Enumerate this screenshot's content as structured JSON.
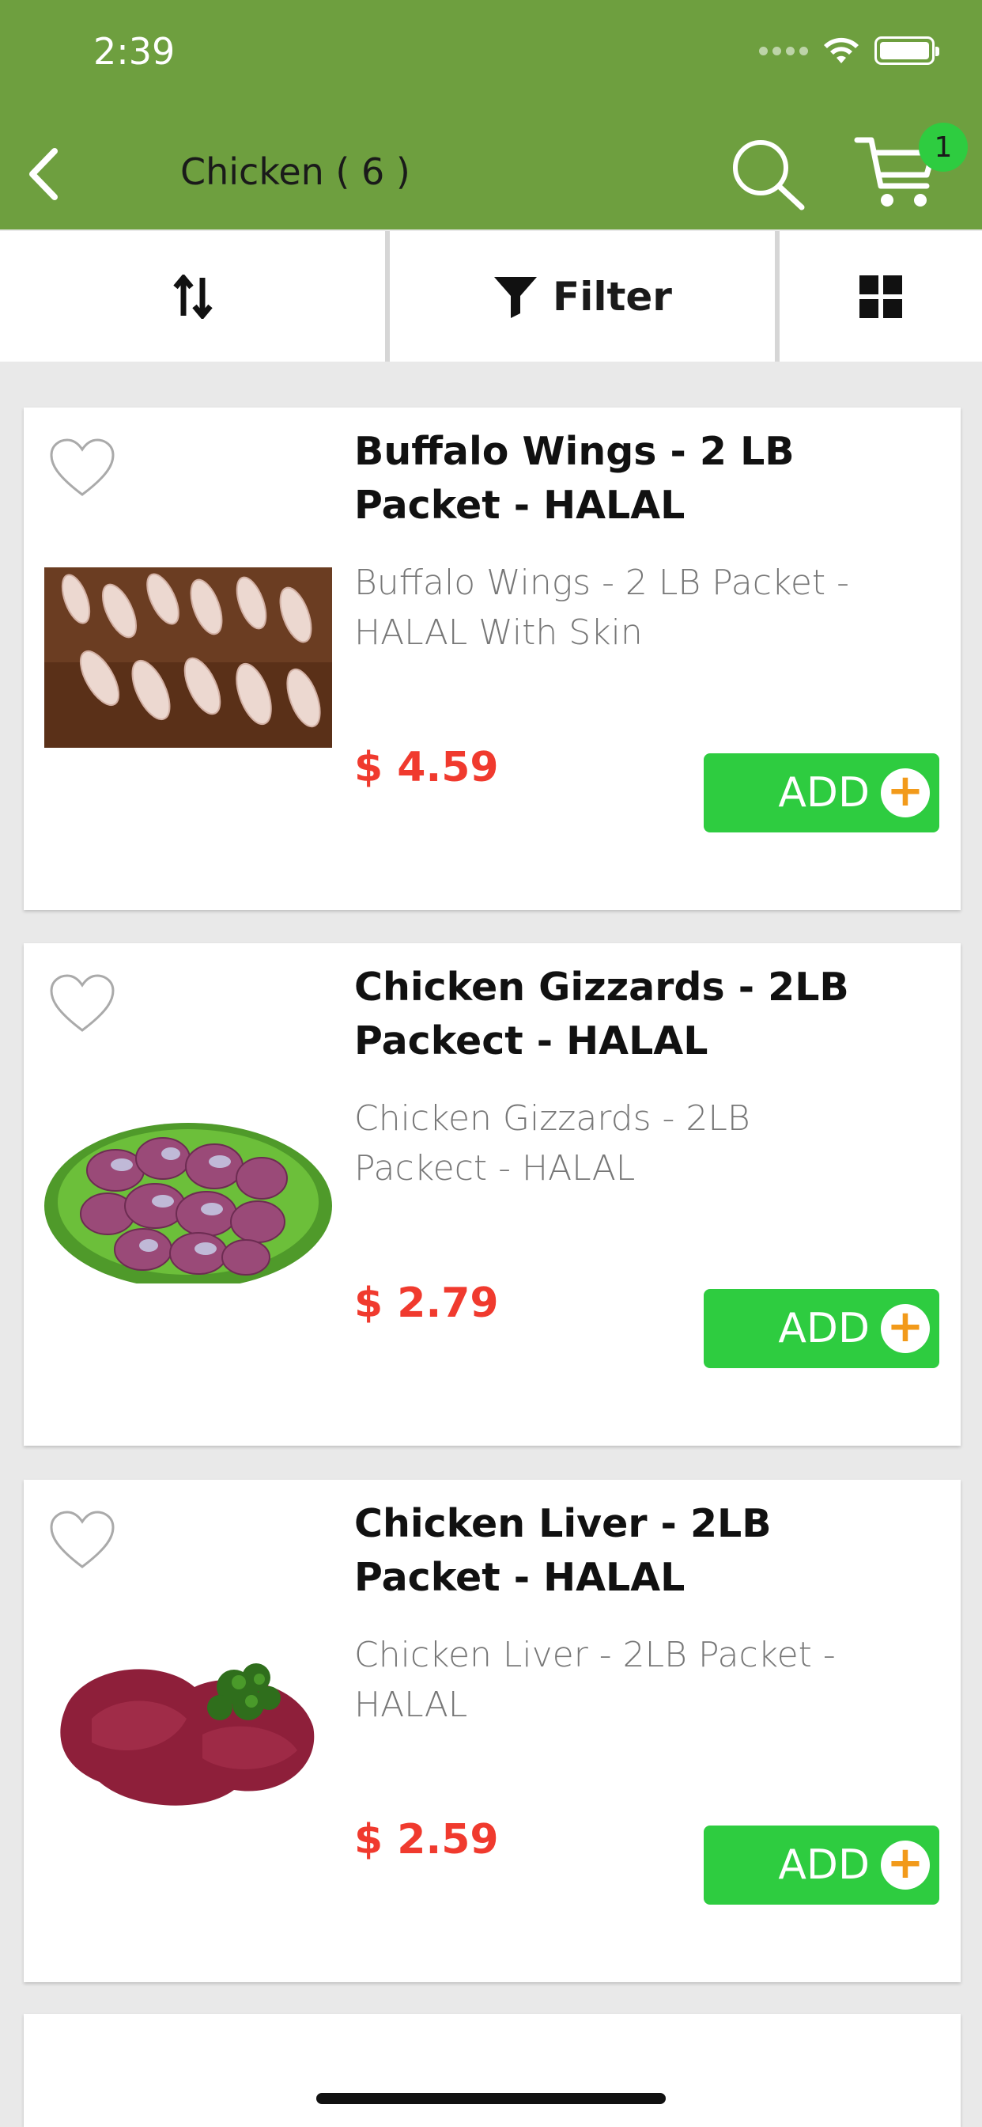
{
  "status_bar": {
    "time": "2:39"
  },
  "header": {
    "title": "Chicken ( 6 )",
    "cart_count": "1",
    "icons": {
      "back": "chevron-left-icon",
      "search": "search-icon",
      "cart": "cart-icon"
    }
  },
  "toolbar": {
    "filter_label": "Filter",
    "icons": {
      "sort": "sort-arrows-icon",
      "filter": "funnel-icon",
      "grid": "grid-view-icon"
    }
  },
  "products": [
    {
      "title": "Buffalo Wings - 2 LB Packet - HALAL",
      "description": "Buffalo Wings - 2 LB Packet - HALAL With Skin",
      "price": "$ 4.59",
      "add_label": "ADD",
      "image": "chicken-wings-image"
    },
    {
      "title": "Chicken Gizzards - 2LB Packect - HALAL",
      "description": "Chicken Gizzards - 2LB Packect - HALAL",
      "price": "$ 2.79",
      "add_label": "ADD",
      "image": "chicken-gizzards-image"
    },
    {
      "title": "Chicken Liver - 2LB Packet - HALAL",
      "description": "Chicken Liver - 2LB Packet - HALAL",
      "price": "$ 2.59",
      "add_label": "ADD",
      "image": "chicken-liver-image"
    }
  ],
  "colors": {
    "header_bg": "#6e9f3f",
    "add_button": "#2ecc40",
    "price": "#f03a2e",
    "plus_icon": "#f29a1a"
  }
}
